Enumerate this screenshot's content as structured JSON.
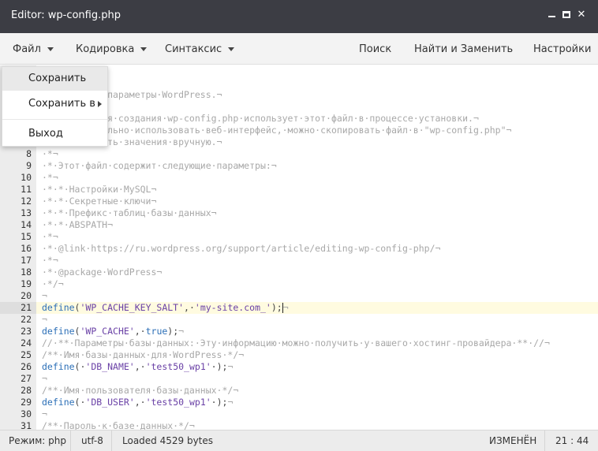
{
  "window": {
    "title": "Editor: wp-config.php",
    "controls": {
      "minimize_icon": "minimize-icon",
      "maximize_icon": "maximize-icon",
      "close": "✕"
    }
  },
  "menubar": {
    "file": "Файл",
    "encoding": "Кодировка",
    "syntax": "Синтаксис",
    "search": "Поиск",
    "find_replace": "Найти и Заменить",
    "settings": "Настройки"
  },
  "file_menu": {
    "save": "Сохранить",
    "save_as": "Сохранить в",
    "exit": "Выход"
  },
  "editor": {
    "active_line": 21,
    "lines": [
      {
        "n": "",
        "parts": [
          [
            "c",
            "·*·Основные·параметры·WordPress.¬"
          ]
        ]
      },
      {
        "n": "",
        "parts": [
          [
            "c",
            "·*¬"
          ]
        ]
      },
      {
        "n": "",
        "parts": [
          [
            "c",
            "·*·Скрипт·для·создания·wp-config.php·использует·этот·файл·в·процессе·установки.¬"
          ]
        ]
      },
      {
        "n": "",
        "parts": [
          [
            "c",
            "·*·Необязательно·использовать·веб-интерфейс,·можно·скопировать·файл·в·\"wp-config.php\"¬"
          ]
        ]
      },
      {
        "n": "",
        "parts": [
          [
            "c",
            "·*·и·заполнить·значения·вручную.¬"
          ]
        ]
      },
      {
        "n": "8",
        "parts": [
          [
            "c",
            "·*¬"
          ]
        ]
      },
      {
        "n": "9",
        "parts": [
          [
            "c",
            "·*·Этот·файл·содержит·следующие·параметры:¬"
          ]
        ]
      },
      {
        "n": "10",
        "parts": [
          [
            "c",
            "·*¬"
          ]
        ]
      },
      {
        "n": "11",
        "parts": [
          [
            "c",
            "·*·*·Настройки·MySQL¬"
          ]
        ]
      },
      {
        "n": "12",
        "parts": [
          [
            "c",
            "·*·*·Секретные·ключи¬"
          ]
        ]
      },
      {
        "n": "13",
        "parts": [
          [
            "c",
            "·*·*·Префикс·таблиц·базы·данных¬"
          ]
        ]
      },
      {
        "n": "14",
        "parts": [
          [
            "c",
            "·*·*·ABSPATH¬"
          ]
        ]
      },
      {
        "n": "15",
        "parts": [
          [
            "c",
            "·*¬"
          ]
        ]
      },
      {
        "n": "16",
        "parts": [
          [
            "c",
            "·*·@link·https://ru.wordpress.org/support/article/editing-wp-config-php/¬"
          ]
        ]
      },
      {
        "n": "17",
        "parts": [
          [
            "c",
            "·*¬"
          ]
        ]
      },
      {
        "n": "18",
        "parts": [
          [
            "c",
            "·*·@package·WordPress¬"
          ]
        ]
      },
      {
        "n": "19",
        "parts": [
          [
            "c",
            "·*/¬"
          ]
        ]
      },
      {
        "n": "20",
        "parts": [
          [
            "c",
            "¬"
          ]
        ]
      },
      {
        "n": "21",
        "parts": [
          [
            "kw",
            "define"
          ],
          [
            "pl",
            "("
          ],
          [
            "str",
            "'WP_CACHE_KEY_SALT'"
          ],
          [
            "pl",
            ",·"
          ],
          [
            "str",
            "'my-site.com_'"
          ],
          [
            "pl",
            ");"
          ],
          [
            "cur",
            ""
          ],
          [
            "c",
            "¬"
          ]
        ]
      },
      {
        "n": "22",
        "parts": [
          [
            "c",
            "¬"
          ]
        ]
      },
      {
        "n": "23",
        "parts": [
          [
            "kw",
            "define"
          ],
          [
            "pl",
            "("
          ],
          [
            "str",
            "'WP_CACHE'"
          ],
          [
            "pl",
            ",·"
          ],
          [
            "kw",
            "true"
          ],
          [
            "pl",
            ");"
          ],
          [
            "c",
            "¬"
          ]
        ]
      },
      {
        "n": "24",
        "parts": [
          [
            "c",
            "//·**·Параметры·базы·данных:·Эту·информацию·можно·получить·у·вашего·хостинг-провайдера·**·//¬"
          ]
        ]
      },
      {
        "n": "25",
        "parts": [
          [
            "c",
            "/**·Имя·базы·данных·для·WordPress·*/¬"
          ]
        ]
      },
      {
        "n": "26",
        "parts": [
          [
            "kw",
            "define"
          ],
          [
            "pl",
            "(·"
          ],
          [
            "str",
            "'DB_NAME'"
          ],
          [
            "pl",
            ",·"
          ],
          [
            "str",
            "'test50_wp1'"
          ],
          [
            "pl",
            "·);"
          ],
          [
            "c",
            "¬"
          ]
        ]
      },
      {
        "n": "27",
        "parts": [
          [
            "c",
            "¬"
          ]
        ]
      },
      {
        "n": "28",
        "parts": [
          [
            "c",
            "/**·Имя·пользователя·базы·данных·*/¬"
          ]
        ]
      },
      {
        "n": "29",
        "parts": [
          [
            "kw",
            "define"
          ],
          [
            "pl",
            "(·"
          ],
          [
            "str",
            "'DB_USER'"
          ],
          [
            "pl",
            ",·"
          ],
          [
            "str",
            "'test50_wp1'"
          ],
          [
            "pl",
            "·);"
          ],
          [
            "c",
            "¬"
          ]
        ]
      },
      {
        "n": "30",
        "parts": [
          [
            "c",
            "¬"
          ]
        ]
      },
      {
        "n": "31",
        "parts": [
          [
            "c",
            "/**·Пароль·к·базе·данных·*/¬"
          ]
        ]
      }
    ]
  },
  "status": {
    "mode": "Режим: php",
    "encoding": "utf-8",
    "loaded": "Loaded 4529 bytes",
    "modified": "ИЗМЕНЁН",
    "position": "21 : 44"
  },
  "colors": {
    "titlebar": "#3c3d44",
    "keyword": "#2c6fb7",
    "string": "#6a41a6",
    "comment": "#a8a8a8",
    "active_line": "#fffbe0"
  }
}
